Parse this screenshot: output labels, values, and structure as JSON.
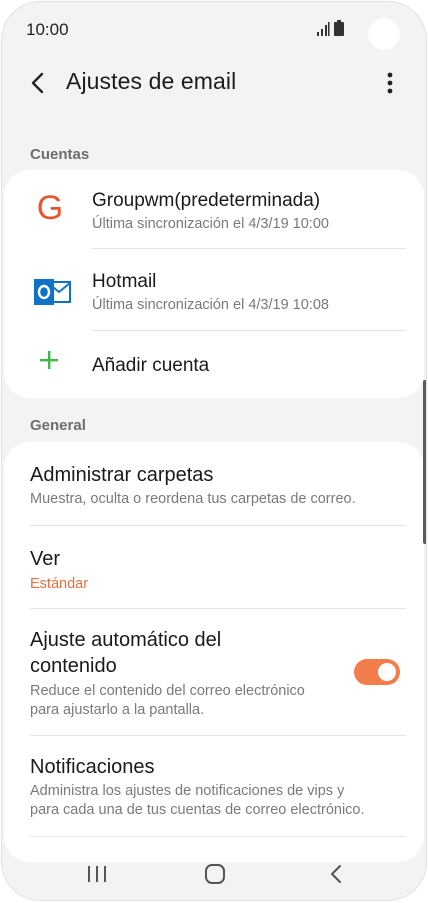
{
  "status": {
    "time": "10:00"
  },
  "appbar": {
    "title": "Ajustes de email"
  },
  "sections": {
    "accounts": "Cuentas",
    "general": "General"
  },
  "accounts": [
    {
      "icon": "gmail-g-icon",
      "letter": "G",
      "name": "Groupwm(predeterminada)",
      "sync": "Última sincronización el 4/3/19  10:00"
    },
    {
      "icon": "outlook-icon",
      "letter": "o",
      "name": "Hotmail",
      "sync": "Última sincronización el 4/3/19  10:08"
    }
  ],
  "add_account": {
    "label": "Añadir cuenta"
  },
  "settings": {
    "folders": {
      "title": "Administrar carpetas",
      "subtitle": "Muestra, oculta o reordena tus carpetas de correo."
    },
    "view": {
      "title": "Ver",
      "value": "Estándar"
    },
    "autofit": {
      "title_line1": "Ajuste automático del",
      "title_line2": "contenido",
      "subtitle_line1": "Reduce el contenido del correo electrónico",
      "subtitle_line2": "para ajustarlo a la pantalla.",
      "enabled": true
    },
    "notifications": {
      "title": "Notificaciones",
      "subtitle_line1": "Administra los ajustes de notificaciones de vips y",
      "subtitle_line2": "para cada una de tus cuentas de correo electrónico."
    }
  },
  "colors": {
    "accent": "#f27c4b",
    "value_text": "#e8703f",
    "gmail_g": "#e8542c",
    "outlook_blue": "#0f72c6",
    "add_green": "#3cb94a"
  }
}
